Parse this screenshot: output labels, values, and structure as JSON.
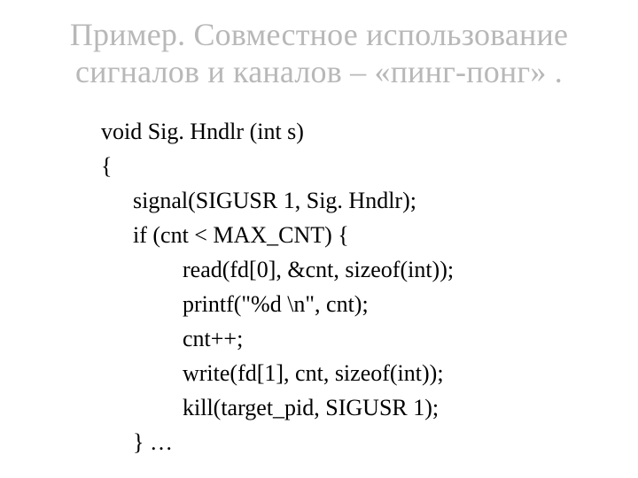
{
  "title": "Пример. Совместное использование сигналов и каналов – «пинг-понг» .",
  "code": {
    "l1": "void Sig. Hndlr (int s)",
    "l2": "{",
    "l3": "signal(SIGUSR 1, Sig. Hndlr);",
    "l4": "if (cnt < MAX_CNT) {",
    "l5": "read(fd[0], &cnt, sizeof(int));",
    "l6": "printf(\"%d \\n\", cnt);",
    "l7": "cnt++;",
    "l8": "write(fd[1], cnt, sizeof(int));",
    "l9": "kill(target_pid, SIGUSR 1);",
    "l10": "} …"
  }
}
